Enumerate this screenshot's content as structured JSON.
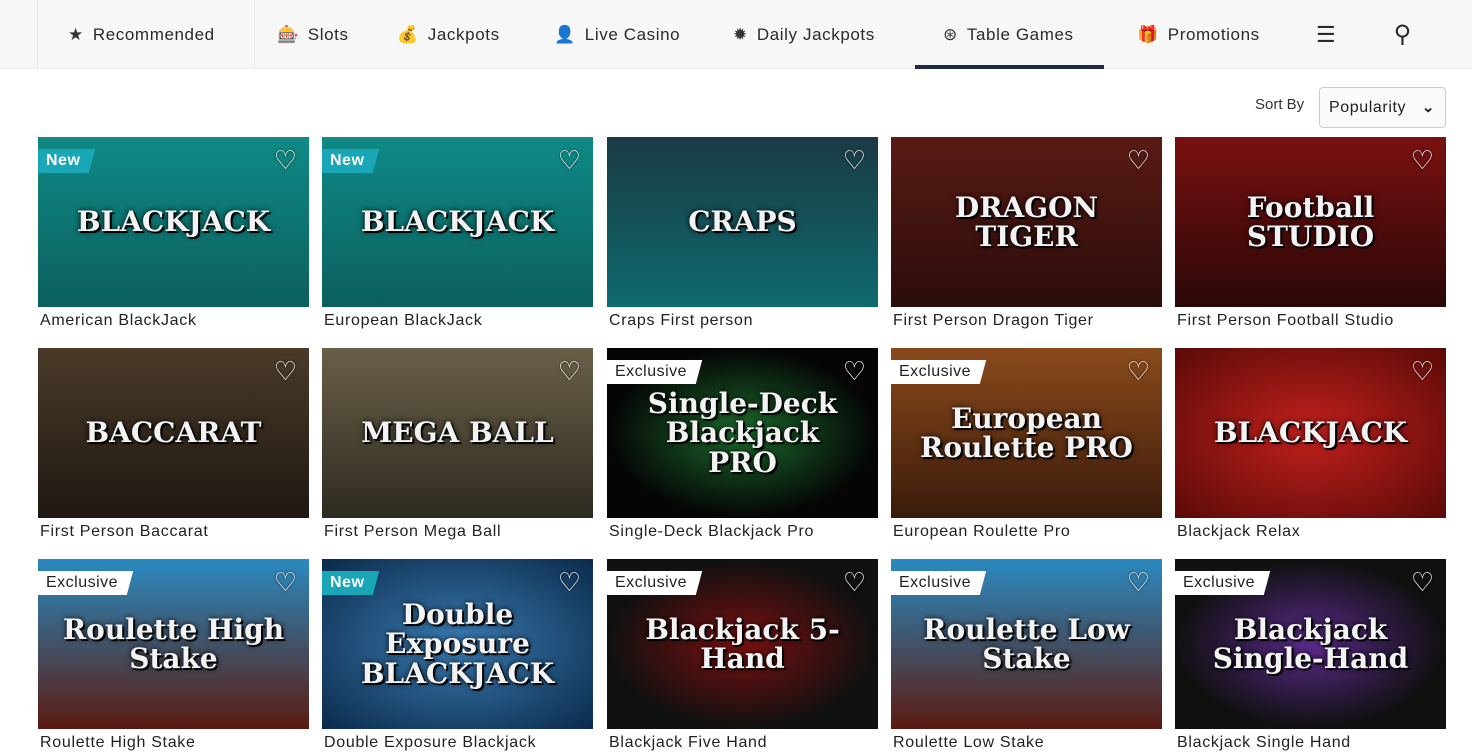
{
  "nav": {
    "tabs": [
      {
        "label": "Recommended",
        "icon": "star-icon",
        "glyph": "★",
        "active": false
      },
      {
        "label": "Slots",
        "icon": "slot-machine-icon",
        "glyph": "🎰",
        "active": false
      },
      {
        "label": "Jackpots",
        "icon": "money-bag-icon",
        "glyph": "💰",
        "active": false
      },
      {
        "label": "Live Casino",
        "icon": "dealer-icon",
        "glyph": "👤",
        "active": false
      },
      {
        "label": "Daily Jackpots",
        "icon": "gear-badge-icon",
        "glyph": "✹",
        "active": false
      },
      {
        "label": "Table Games",
        "icon": "roulette-wheel-icon",
        "glyph": "⊛",
        "active": true
      },
      {
        "label": "Promotions",
        "icon": "gift-icon",
        "glyph": "🎁",
        "active": false
      }
    ],
    "list_icon": "☰",
    "search_icon": "⚲"
  },
  "sort": {
    "label": "Sort By",
    "value": "Popularity"
  },
  "colors": {
    "new_badge": "#19a7b8",
    "active_tab": "#1e2a44"
  },
  "games": [
    {
      "name": "American BlackJack",
      "badge": "New",
      "art": "BLACKJACK",
      "bg": "linear-gradient(#0f8a86,#0b5f5d)"
    },
    {
      "name": "European BlackJack",
      "badge": "New",
      "art": "BLACKJACK",
      "bg": "linear-gradient(#0f8a86,#0b5f5d)"
    },
    {
      "name": "Craps First person",
      "badge": "",
      "art": "CRAPS",
      "bg": "linear-gradient(#1a3a44,#0e6a6e)"
    },
    {
      "name": "First Person Dragon Tiger",
      "badge": "",
      "art": "DRAGON TIGER",
      "bg": "linear-gradient(#5a1a14,#2a0d0a)"
    },
    {
      "name": "First Person Football Studio",
      "badge": "",
      "art": "Football STUDIO",
      "bg": "linear-gradient(#7a1010,#2a0808)"
    },
    {
      "name": "First Person Baccarat",
      "badge": "",
      "art": "BACCARAT",
      "bg": "linear-gradient(#4a3a28,#1e1812)"
    },
    {
      "name": "First Person Mega Ball",
      "badge": "",
      "art": "MEGA BALL",
      "bg": "linear-gradient(#6a6048,#2e2a20)"
    },
    {
      "name": "Single-Deck Blackjack Pro",
      "badge": "Exclusive",
      "art": "Single-Deck Blackjack PRO",
      "bg": "radial-gradient(#1c6a2c,#050505 70%)"
    },
    {
      "name": "European Roulette Pro",
      "badge": "Exclusive",
      "art": "European Roulette PRO",
      "bg": "linear-gradient(#8a4a1c,#3a1a0a)"
    },
    {
      "name": "Blackjack Relax",
      "badge": "",
      "art": "BLACKJACK",
      "bg": "radial-gradient(#c0201c,#5a0a08)"
    },
    {
      "name": "Roulette High Stake",
      "badge": "Exclusive",
      "art": "Roulette High Stake",
      "bg": "linear-gradient(#2a8ac0,#5a1a10)"
    },
    {
      "name": "Double Exposure Blackjack",
      "badge": "New",
      "art": "Double Exposure BLACKJACK",
      "bg": "radial-gradient(#3a7ab0,#0a2a4a)"
    },
    {
      "name": "Blackjack Five Hand",
      "badge": "Exclusive",
      "art": "Blackjack 5-Hand",
      "bg": "radial-gradient(#7a1010,#101010 70%)"
    },
    {
      "name": "Roulette Low Stake",
      "badge": "Exclusive",
      "art": "Roulette Low Stake",
      "bg": "linear-gradient(#2a8ac0,#5a1a10)"
    },
    {
      "name": "Blackjack Single Hand",
      "badge": "Exclusive",
      "art": "Blackjack Single-Hand",
      "bg": "radial-gradient(#5a2a8a,#101010 70%)"
    }
  ]
}
